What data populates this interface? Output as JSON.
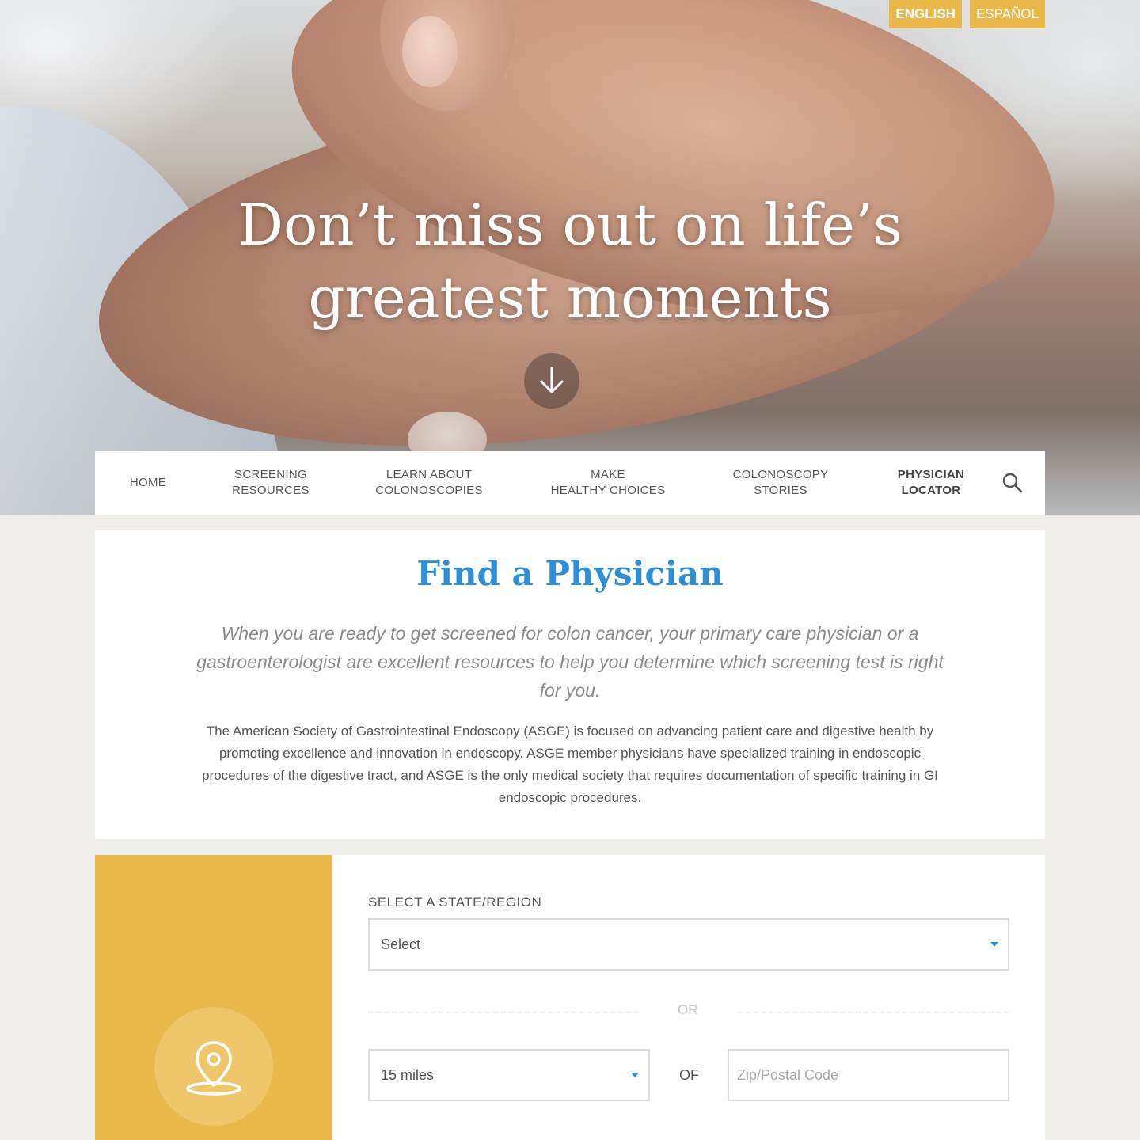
{
  "languages": [
    {
      "label": "ENGLISH",
      "active": true
    },
    {
      "label": "ESPAÑOL",
      "active": false
    }
  ],
  "hero": {
    "title_line1": "Don’t miss out on life’s",
    "title_line2": "greatest moments",
    "scroll_icon": "arrow-down-icon"
  },
  "nav": {
    "items": [
      {
        "line1": "HOME",
        "line2": ""
      },
      {
        "line1": "SCREENING",
        "line2": "RESOURCES"
      },
      {
        "line1": "LEARN ABOUT",
        "line2": "COLONOSCOPIES"
      },
      {
        "line1": "MAKE",
        "line2": "HEALTHY CHOICES"
      },
      {
        "line1": "COLONOSCOPY",
        "line2": "STORIES"
      },
      {
        "line1": "PHYSICIAN",
        "line2": "LOCATOR",
        "active": true
      }
    ],
    "search_icon": "search-icon"
  },
  "intro": {
    "title": "Find a Physician",
    "lead": "When you are ready to get screened for colon cancer, your primary care physician or a gastroenterologist are excellent resources to help you determine which screening test is right for you.",
    "body": "The American Society of Gastrointestinal Endoscopy (ASGE) is focused on advancing patient care and digestive health by promoting excellence and innovation in endoscopy. ASGE member physicians have specialized training in endoscopic procedures of the digestive tract, and ASGE is the only medical society that requires documentation of specific training in GI endoscopic procedures."
  },
  "locator": {
    "icon": "location-pin-icon",
    "state_label": "SELECT A STATE/REGION",
    "state_value": "Select",
    "or_text": "OR",
    "distance_value": "15 miles",
    "of_text": "OF",
    "zip_placeholder": "Zip/Postal Code"
  },
  "colors": {
    "accent_yellow": "#e9b84a",
    "title_blue": "#2e8fd6",
    "page_bg": "#efeeeb"
  }
}
